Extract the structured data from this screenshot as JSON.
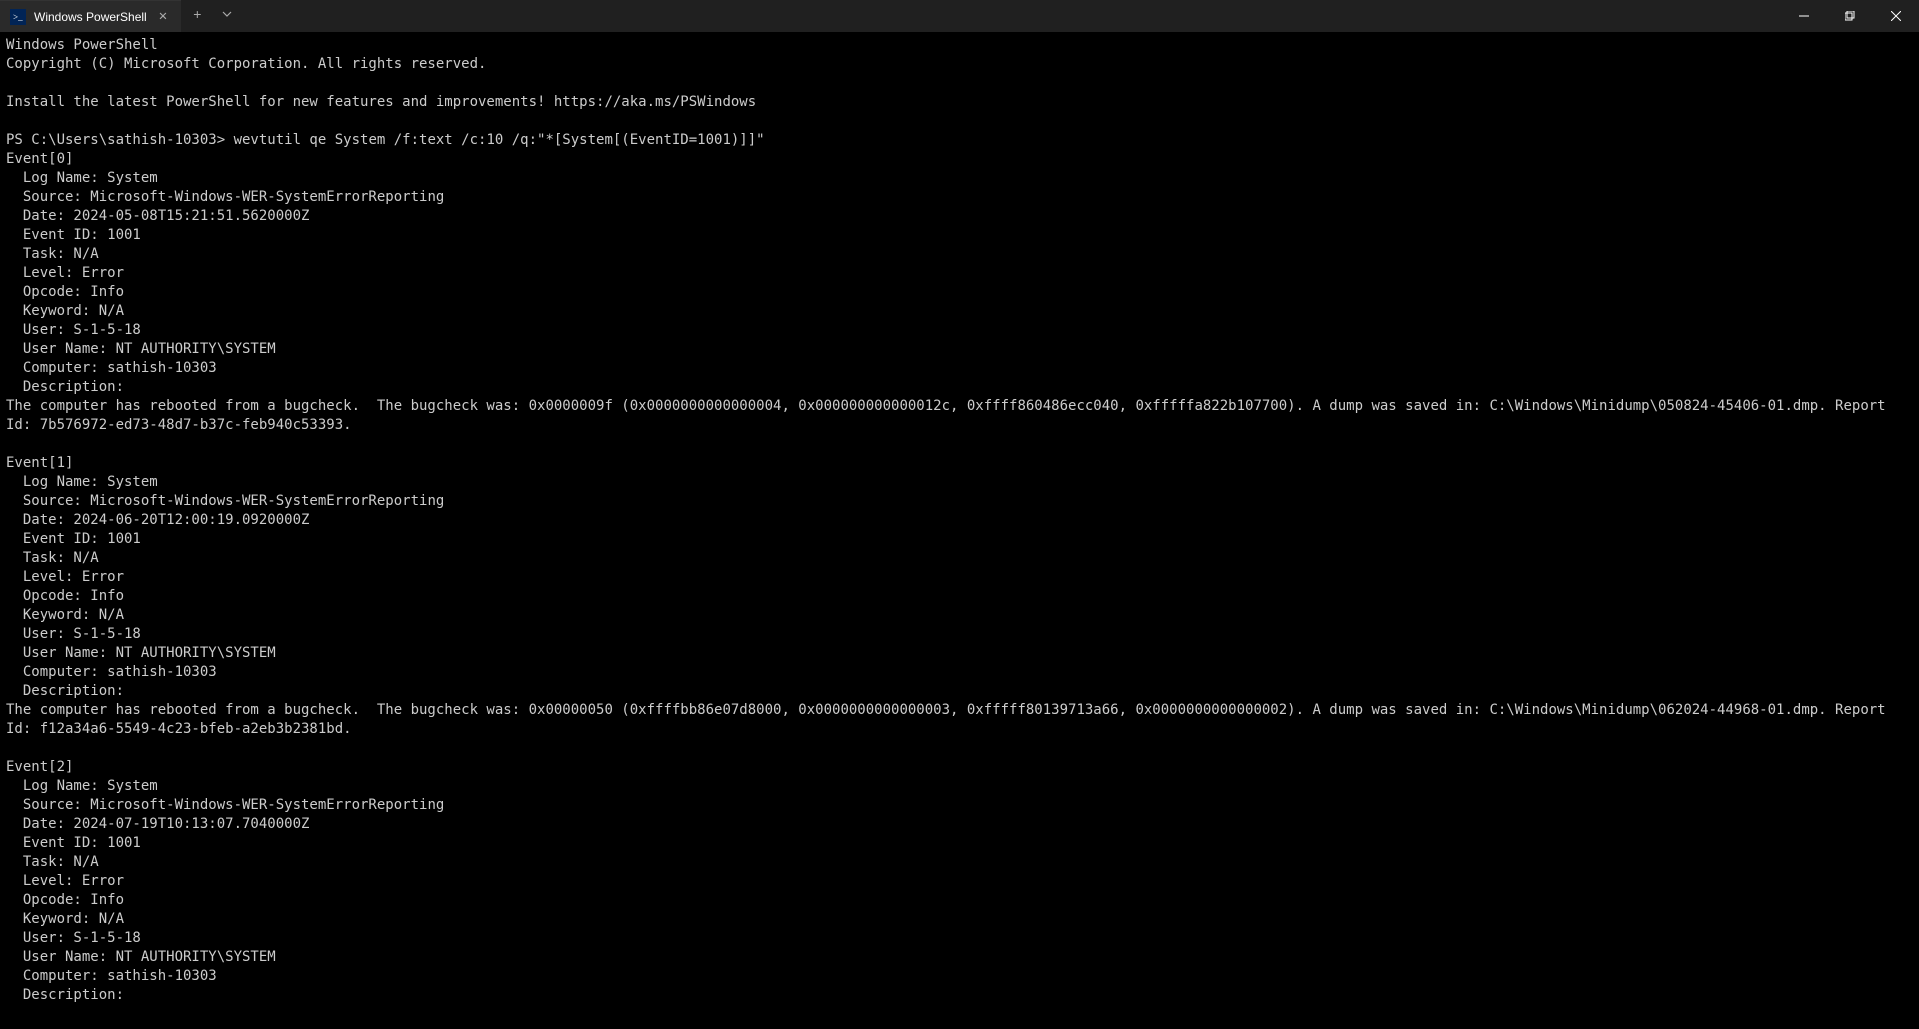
{
  "tab": {
    "title": "Windows PowerShell",
    "icon_text": ">_"
  },
  "header": {
    "line1": "Windows PowerShell",
    "line2": "Copyright (C) Microsoft Corporation. All rights reserved.",
    "install_msg": "Install the latest PowerShell for new features and improvements! https://aka.ms/PSWindows"
  },
  "prompt": "PS C:\\Users\\sathish-10303> ",
  "command": "wevtutil qe System /f:text /c:10 /q:\"*[System[(EventID=1001)]]\"",
  "events": [
    {
      "header": "Event[0]",
      "log_name": "  Log Name: System",
      "source": "  Source: Microsoft-Windows-WER-SystemErrorReporting",
      "date": "  Date: 2024-05-08T15:21:51.5620000Z",
      "event_id": "  Event ID: 1001",
      "task": "  Task: N/A",
      "level": "  Level: Error",
      "opcode": "  Opcode: Info",
      "keyword": "  Keyword: N/A",
      "user": "  User: S-1-5-18",
      "user_name": "  User Name: NT AUTHORITY\\SYSTEM",
      "computer": "  Computer: sathish-10303",
      "description_label": "  Description: ",
      "description": "The computer has rebooted from a bugcheck.  The bugcheck was: 0x0000009f (0x0000000000000004, 0x000000000000012c, 0xffff860486ecc040, 0xfffffa822b107700). A dump was saved in: C:\\Windows\\Minidump\\050824-45406-01.dmp. Report Id: 7b576972-ed73-48d7-b37c-feb940c53393."
    },
    {
      "header": "Event[1]",
      "log_name": "  Log Name: System",
      "source": "  Source: Microsoft-Windows-WER-SystemErrorReporting",
      "date": "  Date: 2024-06-20T12:00:19.0920000Z",
      "event_id": "  Event ID: 1001",
      "task": "  Task: N/A",
      "level": "  Level: Error",
      "opcode": "  Opcode: Info",
      "keyword": "  Keyword: N/A",
      "user": "  User: S-1-5-18",
      "user_name": "  User Name: NT AUTHORITY\\SYSTEM",
      "computer": "  Computer: sathish-10303",
      "description_label": "  Description: ",
      "description": "The computer has rebooted from a bugcheck.  The bugcheck was: 0x00000050 (0xffffbb86e07d8000, 0x0000000000000003, 0xfffff80139713a66, 0x0000000000000002). A dump was saved in: C:\\Windows\\Minidump\\062024-44968-01.dmp. Report Id: f12a34a6-5549-4c23-bfeb-a2eb3b2381bd."
    },
    {
      "header": "Event[2]",
      "log_name": "  Log Name: System",
      "source": "  Source: Microsoft-Windows-WER-SystemErrorReporting",
      "date": "  Date: 2024-07-19T10:13:07.7040000Z",
      "event_id": "  Event ID: 1001",
      "task": "  Task: N/A",
      "level": "  Level: Error",
      "opcode": "  Opcode: Info",
      "keyword": "  Keyword: N/A",
      "user": "  User: S-1-5-18",
      "user_name": "  User Name: NT AUTHORITY\\SYSTEM",
      "computer": "  Computer: sathish-10303",
      "description_label": "  Description: "
    }
  ]
}
